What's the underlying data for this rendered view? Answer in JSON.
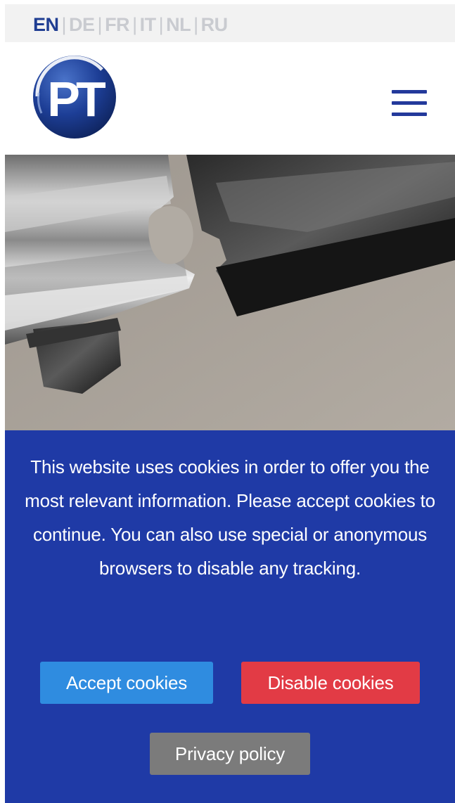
{
  "languages": [
    {
      "code": "EN",
      "active": true
    },
    {
      "code": "DE",
      "active": false
    },
    {
      "code": "FR",
      "active": false
    },
    {
      "code": "IT",
      "active": false
    },
    {
      "code": "NL",
      "active": false
    },
    {
      "code": "RU",
      "active": false
    }
  ],
  "language_separator": "|",
  "header": {
    "logo_text": "PT",
    "menu_icon": "hamburger-menu-icon"
  },
  "hero": {
    "image": "machined-metal-rollers-photo"
  },
  "cookie_banner": {
    "message": "This website uses cookies in order to offer you the most relevant information. Please accept cookies to continue. You can also use special or anonymous browsers to disable any tracking.",
    "accept_label": "Accept cookies",
    "disable_label": "Disable cookies",
    "privacy_label": "Privacy policy"
  },
  "colors": {
    "brand_blue": "#1f3d92",
    "banner_bg": "#1f3aa6",
    "accept_bg": "#2f8ce0",
    "disable_bg": "#e23b45",
    "privacy_bg": "#7b7b7b",
    "inactive_lang": "#c9cbd0"
  }
}
